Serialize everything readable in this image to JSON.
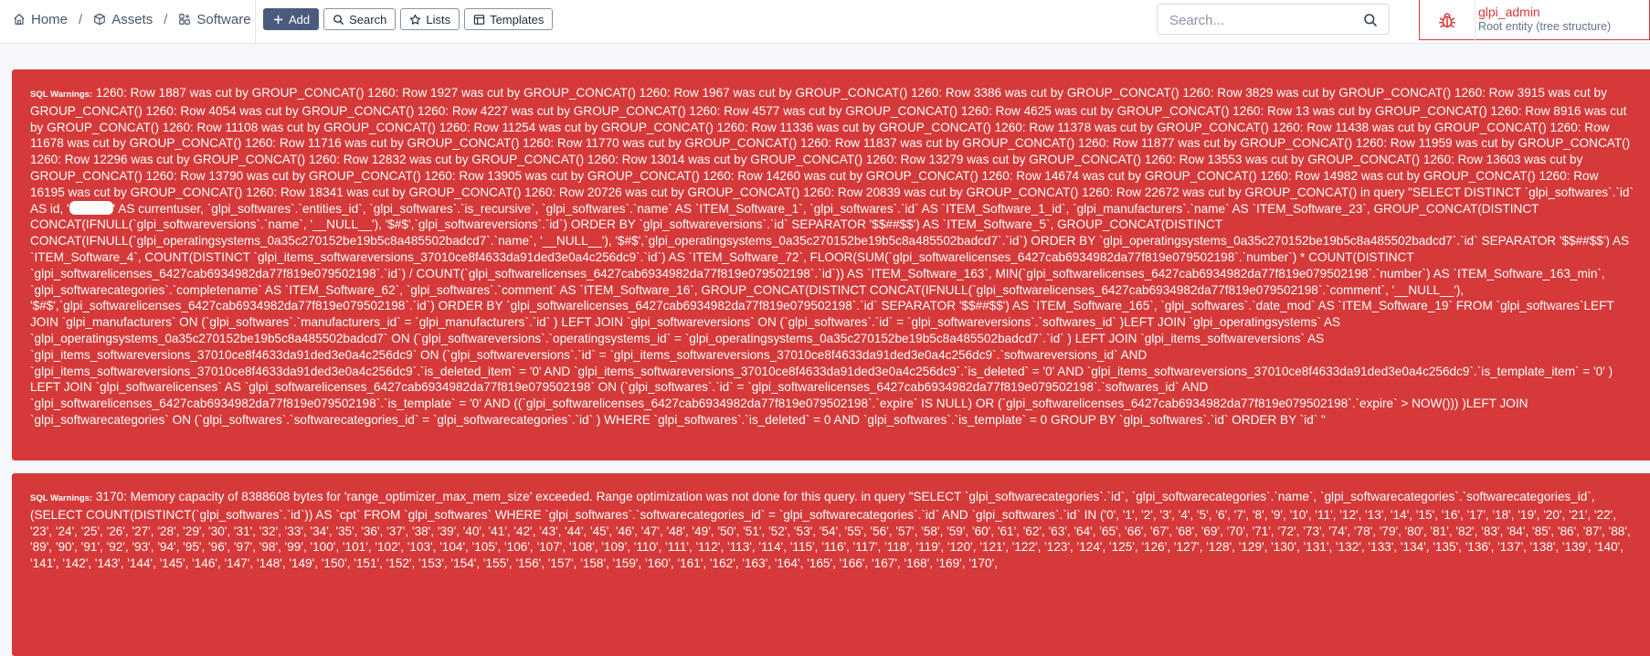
{
  "breadcrumb": {
    "home": "Home",
    "assets": "Assets",
    "software": "Software",
    "separator": "/"
  },
  "toolbar": {
    "add": "Add",
    "search": "Search",
    "lists": "Lists",
    "templates": "Templates"
  },
  "global_search": {
    "placeholder": "Search..."
  },
  "user": {
    "name": "glpi_admin",
    "entity": "Root entity (tree structure)"
  },
  "colors": {
    "alert": "#d63939",
    "primary_button": "#4a5c7e"
  },
  "warnings": [
    {
      "label": "SQL Warnings:",
      "text_before": "1260: Row 1887 was cut by GROUP_CONCAT() 1260: Row 1927 was cut by GROUP_CONCAT() 1260: Row 1967 was cut by GROUP_CONCAT() 1260: Row 3386 was cut by GROUP_CONCAT() 1260: Row 3829 was cut by GROUP_CONCAT() 1260: Row 3915 was cut by GROUP_CONCAT() 1260: Row 4054 was cut by GROUP_CONCAT() 1260: Row 4227 was cut by GROUP_CONCAT() 1260: Row 4577 was cut by GROUP_CONCAT() 1260: Row 4625 was cut by GROUP_CONCAT() 1260: Row 13 was cut by GROUP_CONCAT() 1260: Row 8916 was cut by GROUP_CONCAT() 1260: Row 11108 was cut by GROUP_CONCAT() 1260: Row 11254 was cut by GROUP_CONCAT() 1260: Row 11336 was cut by GROUP_CONCAT() 1260: Row 11378 was cut by GROUP_CONCAT() 1260: Row 11438 was cut by GROUP_CONCAT() 1260: Row 11678 was cut by GROUP_CONCAT() 1260: Row 11716 was cut by GROUP_CONCAT() 1260: Row 11770 was cut by GROUP_CONCAT() 1260: Row 11837 was cut by GROUP_CONCAT() 1260: Row 11877 was cut by GROUP_CONCAT() 1260: Row 11959 was cut by GROUP_CONCAT() 1260: Row 12296 was cut by GROUP_CONCAT() 1260: Row 12832 was cut by GROUP_CONCAT() 1260: Row 13014 was cut by GROUP_CONCAT() 1260: Row 13279 was cut by GROUP_CONCAT() 1260: Row 13553 was cut by GROUP_CONCAT() 1260: Row 13603 was cut by GROUP_CONCAT() 1260: Row 13790 was cut by GROUP_CONCAT() 1260: Row 13905 was cut by GROUP_CONCAT() 1260: Row 14260 was cut by GROUP_CONCAT() 1260: Row 14674 was cut by GROUP_CONCAT() 1260: Row 14982 was cut by GROUP_CONCAT() 1260: Row 16195 was cut by GROUP_CONCAT() 1260: Row 18341 was cut by GROUP_CONCAT() 1260: Row 20726 was cut by GROUP_CONCAT() 1260: Row 20839 was cut by GROUP_CONCAT() 1260: Row 22672 was cut by GROUP_CONCAT() in query \"SELECT DISTINCT `glpi_softwares`.`id` AS id, '",
      "text_after": "' AS currentuser, `glpi_softwares`.`entities_id`, `glpi_softwares`.`is_recursive`, `glpi_softwares`.`name` AS `ITEM_Software_1`, `glpi_softwares`.`id` AS `ITEM_Software_1_id`, `glpi_manufacturers`.`name` AS `ITEM_Software_23`, GROUP_CONCAT(DISTINCT CONCAT(IFNULL(`glpi_softwareversions`.`name`, '__NULL__'), '$#$',`glpi_softwareversions`.`id`) ORDER BY `glpi_softwareversions`.`id` SEPARATOR '$$##$$') AS `ITEM_Software_5`, GROUP_CONCAT(DISTINCT CONCAT(IFNULL(`glpi_operatingsystems_0a35c270152be19b5c8a485502badcd7`.`name`, '__NULL__'), '$#$',`glpi_operatingsystems_0a35c270152be19b5c8a485502badcd7`.`id`) ORDER BY `glpi_operatingsystems_0a35c270152be19b5c8a485502badcd7`.`id` SEPARATOR '$$##$$') AS `ITEM_Software_4`, COUNT(DISTINCT `glpi_items_softwareversions_37010ce8f4633da91ded3e0a4c256dc9`.`id`) AS `ITEM_Software_72`, FLOOR(SUM(`glpi_softwarelicenses_6427cab6934982da77f819e079502198`.`number`) * COUNT(DISTINCT `glpi_softwarelicenses_6427cab6934982da77f819e079502198`.`id`) / COUNT(`glpi_softwarelicenses_6427cab6934982da77f819e079502198`.`id`)) AS `ITEM_Software_163`, MIN(`glpi_softwarelicenses_6427cab6934982da77f819e079502198`.`number`) AS `ITEM_Software_163_min`, `glpi_softwarecategories`.`completename` AS `ITEM_Software_62`, `glpi_softwares`.`comment` AS `ITEM_Software_16`, GROUP_CONCAT(DISTINCT CONCAT(IFNULL(`glpi_softwarelicenses_6427cab6934982da77f819e079502198`.`comment`, '__NULL__'), '$#$',`glpi_softwarelicenses_6427cab6934982da77f819e079502198`.`id`) ORDER BY `glpi_softwarelicenses_6427cab6934982da77f819e079502198`.`id` SEPARATOR '$$##$$') AS `ITEM_Software_165`, `glpi_softwares`.`date_mod` AS `ITEM_Software_19` FROM `glpi_softwares`LEFT JOIN `glpi_manufacturers` ON (`glpi_softwares`.`manufacturers_id` = `glpi_manufacturers`.`id` ) LEFT JOIN `glpi_softwareversions` ON (`glpi_softwares`.`id` = `glpi_softwareversions`.`softwares_id` )LEFT JOIN `glpi_operatingsystems` AS `glpi_operatingsystems_0a35c270152be19b5c8a485502badcd7` ON (`glpi_softwareversions`.`operatingsystems_id` = `glpi_operatingsystems_0a35c270152be19b5c8a485502badcd7`.`id` ) LEFT JOIN `glpi_items_softwareversions` AS `glpi_items_softwareversions_37010ce8f4633da91ded3e0a4c256dc9` ON (`glpi_softwareversions`.`id` = `glpi_items_softwareversions_37010ce8f4633da91ded3e0a4c256dc9`.`softwareversions_id` AND `glpi_items_softwareversions_37010ce8f4633da91ded3e0a4c256dc9`.`is_deleted_item` = '0' AND `glpi_items_softwareversions_37010ce8f4633da91ded3e0a4c256dc9`.`is_deleted` = '0' AND `glpi_items_softwareversions_37010ce8f4633da91ded3e0a4c256dc9`.`is_template_item` = '0' ) LEFT JOIN `glpi_softwarelicenses` AS `glpi_softwarelicenses_6427cab6934982da77f819e079502198` ON (`glpi_softwares`.`id` = `glpi_softwarelicenses_6427cab6934982da77f819e079502198`.`softwares_id` AND `glpi_softwarelicenses_6427cab6934982da77f819e079502198`.`is_template` = '0' AND ((`glpi_softwarelicenses_6427cab6934982da77f819e079502198`.`expire` IS NULL) OR (`glpi_softwarelicenses_6427cab6934982da77f819e079502198`.`expire` > NOW())) )LEFT JOIN `glpi_softwarecategories` ON (`glpi_softwares`.`softwarecategories_id` = `glpi_softwarecategories`.`id` ) WHERE `glpi_softwares`.`is_deleted` = 0 AND `glpi_softwares`.`is_template` = 0 GROUP BY `glpi_softwares`.`id` ORDER BY `id` \""
    },
    {
      "label": "SQL Warnings:",
      "text": "3170: Memory capacity of 8388608 bytes for 'range_optimizer_max_mem_size' exceeded. Range optimization was not done for this query. in query \"SELECT `glpi_softwarecategories`.`id`, `glpi_softwarecategories`.`name`, `glpi_softwarecategories`.`softwarecategories_id`, (SELECT COUNT(DISTINCT(`glpi_softwares`.`id`)) AS `cpt` FROM `glpi_softwares` WHERE `glpi_softwares`.`softwarecategories_id` = `glpi_softwarecategories`.`id` AND `glpi_softwares`.`id` IN ('0', '1', '2', '3', '4', '5', '6', '7', '8', '9', '10', '11', '12', '13', '14', '15', '16', '17', '18', '19', '20', '21', '22', '23', '24', '25', '26', '27', '28', '29', '30', '31', '32', '33', '34', '35', '36', '37', '38', '39', '40', '41', '42', '43', '44', '45', '46', '47', '48', '49', '50', '51', '52', '53', '54', '55', '56', '57', '58', '59', '60', '61', '62', '63', '64', '65', '66', '67', '68', '69', '70', '71', '72', '73', '74', '78', '79', '80', '81', '82', '83', '84', '85', '86', '87', '88', '89', '90', '91', '92', '93', '94', '95', '96', '97', '98', '99', '100', '101', '102', '103', '104', '105', '106', '107', '108', '109', '110', '111', '112', '113', '114', '115', '116', '117', '118', '119', '120', '121', '122', '123', '124', '125', '126', '127', '128', '129', '130', '131', '132', '133', '134', '135', '136', '137', '138', '139', '140', '141', '142', '143', '144', '145', '146', '147', '148', '149', '150', '151', '152', '153', '154', '155', '156', '157', '158', '159', '160', '161', '162', '163', '164', '165', '166', '167', '168', '169', '170',"
    }
  ]
}
